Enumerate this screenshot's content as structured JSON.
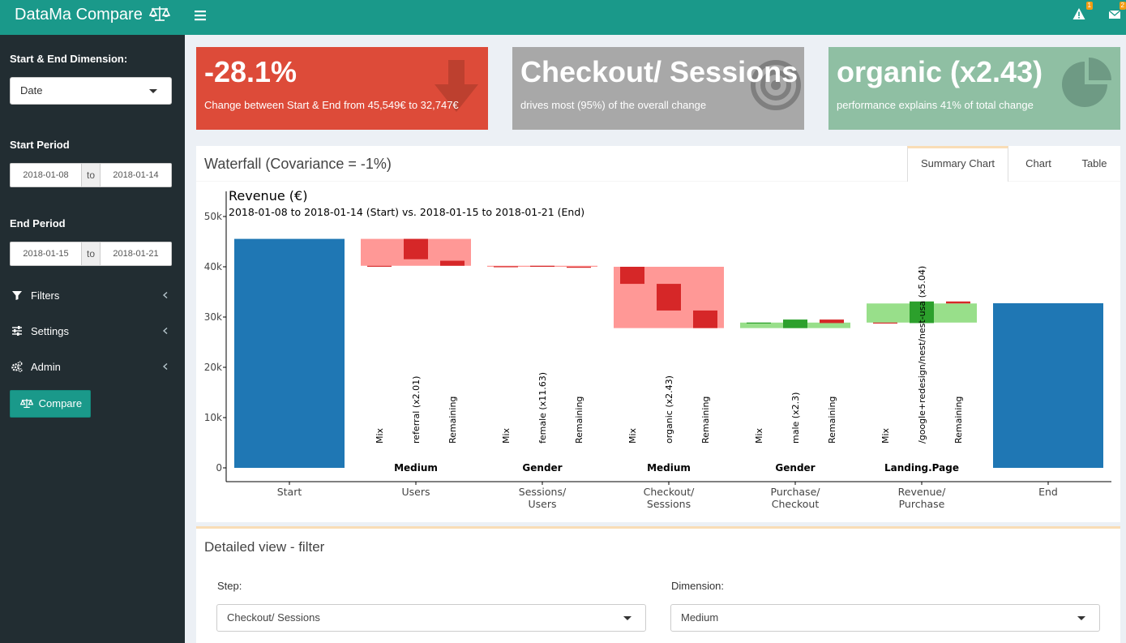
{
  "app": {
    "title": "DataMa Compare",
    "alert_count": "1",
    "message_count": "2"
  },
  "sidebar": {
    "dimension_label": "Start & End Dimension:",
    "dimension_value": "Date",
    "start_label": "Start Period",
    "start_from": "2018-01-08",
    "start_to": "2018-01-14",
    "end_label": "End Period",
    "end_from": "2018-01-15",
    "end_to": "2018-01-21",
    "to_text": "to",
    "menu": [
      {
        "label": "Filters",
        "icon": "filter-icon"
      },
      {
        "label": "Settings",
        "icon": "sliders-icon"
      },
      {
        "label": "Admin",
        "icon": "cogs-icon"
      }
    ],
    "compare_label": "Compare"
  },
  "value_boxes": [
    {
      "value": "-28.1%",
      "subtitle": "Change between Start & End from 45,549€ to 32,747€",
      "color": "#dd4b39",
      "icon": "arrow-down-icon"
    },
    {
      "value": "Checkout/ Sessions",
      "subtitle": "drives most (95%) of the overall change",
      "color": "#a8a8a8",
      "icon": "bullseye-icon"
    },
    {
      "value": "organic (x2.43)",
      "subtitle": "performance explains 41% of total change",
      "color": "#8fbfa3",
      "icon": "pie-chart-icon"
    }
  ],
  "waterfall_box": {
    "title": "Waterfall (Covariance = -1%)",
    "tabs": [
      "Summary Chart",
      "Chart",
      "Table"
    ],
    "active_tab": "Summary Chart"
  },
  "chart_data": {
    "type": "bar",
    "title": "Revenue (€)",
    "subtitle": "2018-01-08 to 2018-01-14 (Start) vs. 2018-01-15 to 2018-01-21 (End)",
    "ylim": [
      0,
      52000
    ],
    "yticks": [
      0,
      10000,
      20000,
      30000,
      40000,
      50000
    ],
    "ytick_labels": [
      "0",
      "10k",
      "20k",
      "30k",
      "40k",
      "50k"
    ],
    "grid": false,
    "colors": {
      "total": "#1f77b4",
      "neg_light": "#ff9896",
      "neg_dark": "#d62728",
      "pos_light": "#98df8a",
      "pos_dark": "#2ca02c"
    },
    "categories": [
      "Start",
      "Users",
      "Sessions/\nUsers",
      "Checkout/\nSessions",
      "Purchase/\nCheckout",
      "Revenue/\nPurchase",
      "End"
    ],
    "totals": [
      {
        "category": 0,
        "value": 45549
      },
      {
        "category": 6,
        "value": 32747
      }
    ],
    "steps": [
      {
        "category": 1,
        "dimension": "Medium",
        "from": 45549,
        "to": 40200,
        "parts": [
          {
            "label": "Mix",
            "from": 40200,
            "to": 40200
          },
          {
            "label": "referral (x2.01)",
            "from": 45549,
            "to": 41500
          },
          {
            "label": "Remaining",
            "from": 41200,
            "to": 40200
          }
        ]
      },
      {
        "category": 2,
        "dimension": "Gender",
        "from": 40200,
        "to": 40000,
        "parts": [
          {
            "label": "Mix",
            "from": 40100,
            "to": 40100
          },
          {
            "label": "female (x11.63)",
            "from": 40200,
            "to": 40000
          },
          {
            "label": "Remaining",
            "from": 40000,
            "to": 40000
          }
        ]
      },
      {
        "category": 3,
        "dimension": "Medium",
        "from": 40000,
        "to": 27800,
        "parts": [
          {
            "label": "Mix",
            "from": 40000,
            "to": 36600
          },
          {
            "label": "organic (x2.43)",
            "from": 36600,
            "to": 31300
          },
          {
            "label": "Remaining",
            "from": 31300,
            "to": 27800
          }
        ]
      },
      {
        "category": 4,
        "dimension": "Gender",
        "from": 27800,
        "to": 28900,
        "parts": [
          {
            "label": "Mix",
            "from": 28900,
            "to": 28900
          },
          {
            "label": "male (x2.3)",
            "from": 27800,
            "to": 29500
          },
          {
            "label": "Remaining",
            "from": 29500,
            "to": 28800
          }
        ]
      },
      {
        "category": 5,
        "dimension": "Landing.Page",
        "from": 28900,
        "to": 32700,
        "parts": [
          {
            "label": "Mix",
            "from": 28900,
            "to": 28800
          },
          {
            "label": "/google+redesign/nest/nest-usa (x5.04)",
            "from": 28800,
            "to": 33100
          },
          {
            "label": "Remaining",
            "from": 33100,
            "to": 32700
          }
        ]
      }
    ]
  },
  "detail_box": {
    "title": "Detailed view - filter",
    "step_label": "Step:",
    "step_value": "Checkout/ Sessions",
    "dimension_label": "Dimension:",
    "dimension_value": "Medium"
  }
}
